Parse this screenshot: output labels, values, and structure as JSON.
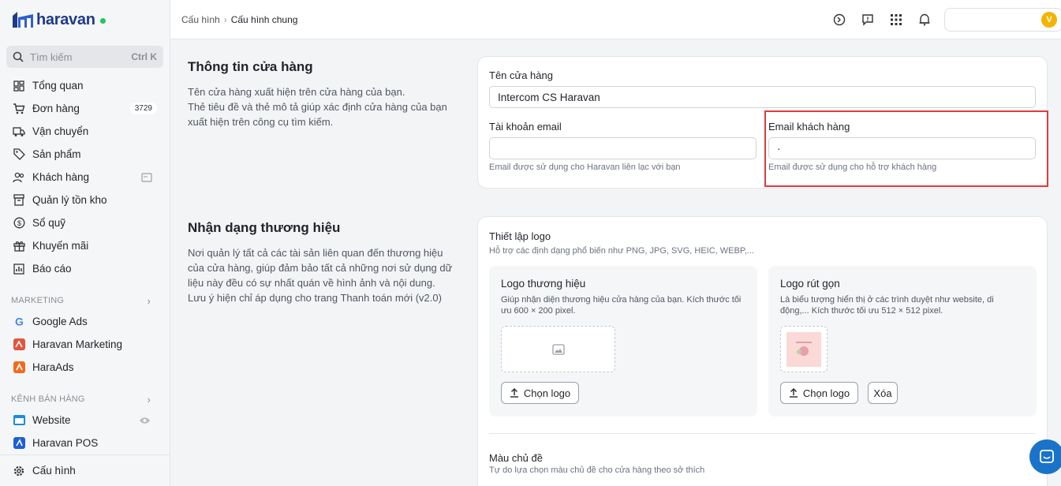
{
  "app": {
    "brand": "haravan",
    "brand_color": "#1e3a8a",
    "status_dot_color": "#22c55e"
  },
  "sidebar": {
    "search_placeholder": "Tìm kiếm",
    "search_shortcut": "Ctrl K",
    "items": [
      {
        "label": "Tổng quan",
        "icon": "dashboard-icon"
      },
      {
        "label": "Đơn hàng",
        "icon": "cart-icon",
        "badge": "3729"
      },
      {
        "label": "Vận chuyển",
        "icon": "truck-icon"
      },
      {
        "label": "Sản phẩm",
        "icon": "tag-icon"
      },
      {
        "label": "Khách hàng",
        "icon": "users-icon"
      },
      {
        "label": "Quản lý tồn kho",
        "icon": "inventory-icon"
      },
      {
        "label": "Sổ quỹ",
        "icon": "dollar-icon"
      },
      {
        "label": "Khuyến mãi",
        "icon": "gift-icon"
      },
      {
        "label": "Báo cáo",
        "icon": "report-icon"
      }
    ],
    "marketing_label": "MARKETING",
    "marketing_items": [
      {
        "label": "Google Ads",
        "icon": "google-icon"
      },
      {
        "label": "Haravan Marketing",
        "icon": "haravan-marketing-icon"
      },
      {
        "label": "HaraAds",
        "icon": "haraads-icon"
      }
    ],
    "channels_label": "KÊNH BÁN HÀNG",
    "channel_items": [
      {
        "label": "Website",
        "icon": "website-icon"
      },
      {
        "label": "Haravan POS",
        "icon": "pos-icon"
      }
    ],
    "settings_label": "Cấu hình"
  },
  "header": {
    "breadcrumb_parent": "Cấu hình",
    "breadcrumb_current": "Cấu hình chung",
    "avatar_initial": "V"
  },
  "store_info": {
    "title": "Thông tin cửa hàng",
    "desc_1": "Tên cửa hàng xuất hiện trên cửa hàng của bạn.",
    "desc_2": "Thẻ tiêu đề và thẻ mô tả giúp xác định cửa hàng của bạn xuất hiện trên công cụ tìm kiếm.",
    "store_name_label": "Tên cửa hàng",
    "store_name_value": "Intercom CS Haravan",
    "account_email_label": "Tài khoản email",
    "account_email_value": "",
    "account_email_hint": "Email được sử dụng cho Haravan liên lạc với bạn",
    "customer_email_label": "Email khách hàng",
    "customer_email_value": "·",
    "customer_email_hint": "Email được sử dụng cho hỗ trợ khách hàng"
  },
  "brand_identity": {
    "title": "Nhận dạng thương hiệu",
    "desc_1": "Nơi quản lý tất cả các tài sản liên quan đến thương hiệu của cửa hàng, giúp đảm bảo tất cả những nơi sử dụng dữ liệu này đều có sự nhất quán về hình ảnh và nội dung.",
    "desc_2": "Lưu ý hiện chỉ áp dụng cho trang Thanh toán mới (v2.0)",
    "logo_setup_title": "Thiết lập logo",
    "logo_setup_hint": "Hỗ trợ các định dạng phổ biến như PNG, JPG, SVG, HEIC, WEBP,...",
    "brand_logo_title": "Logo thương hiệu",
    "brand_logo_desc": "Giúp nhận diện thương hiệu cửa hàng của bạn. Kích thước tối ưu 600 × 200 pixel.",
    "short_logo_title": "Logo rút gọn",
    "short_logo_desc": "Là biểu tượng hiển thị ở các trình duyệt như website, di động,... Kích thước tối ưu 512 × 512 pixel.",
    "choose_logo_label": "Chọn logo",
    "delete_label": "Xóa",
    "theme_color_title": "Màu chủ đề",
    "theme_color_hint": "Tự do lựa chọn màu chủ đề cho cửa hàng theo sở thích"
  },
  "colors": {
    "highlight": "#e03b3b",
    "chat": "#1a73c9",
    "avatar": "#f5b301"
  }
}
